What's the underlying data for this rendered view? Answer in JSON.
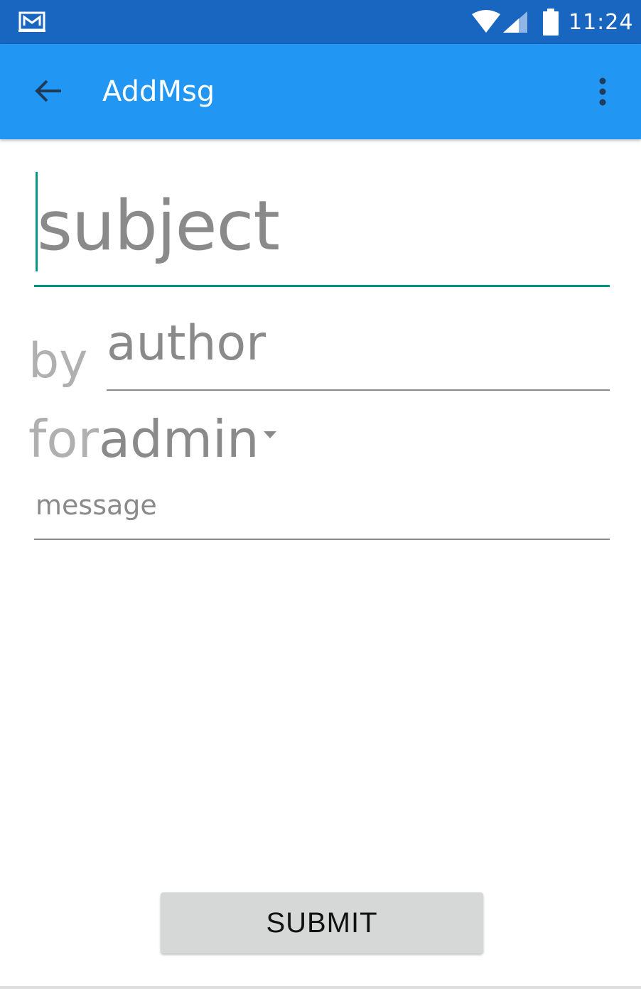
{
  "status_bar": {
    "time": "11:24",
    "background": "#1866c0",
    "icons": [
      "mail-notification-icon",
      "wifi-icon",
      "cell-signal-icon",
      "battery-icon"
    ]
  },
  "app_bar": {
    "title": "AddMsg",
    "background": "#2196f3",
    "back_icon": "arrow-back-icon",
    "overflow_icon": "more-vert-icon"
  },
  "form": {
    "subject": {
      "value": "",
      "placeholder": "subject"
    },
    "by_label": "by",
    "author": {
      "value": "",
      "placeholder": "author"
    },
    "for_label": "for",
    "recipient": {
      "selected": "admin"
    },
    "message": {
      "value": "",
      "placeholder": "message"
    },
    "accent_color": "#009688"
  },
  "submit": {
    "label": "SUBMIT"
  }
}
